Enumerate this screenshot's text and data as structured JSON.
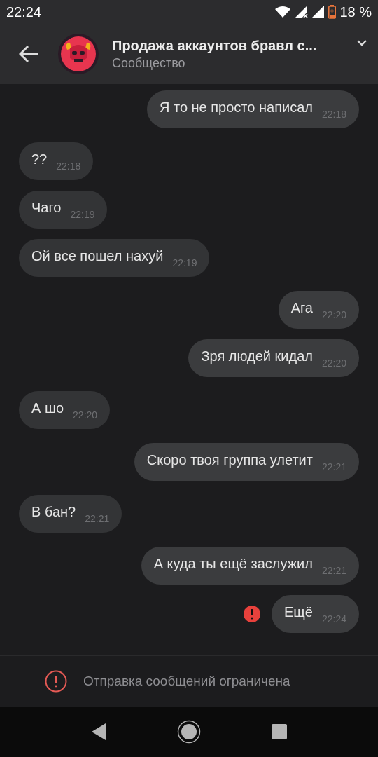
{
  "status_bar": {
    "time": "22:24",
    "battery": "18 %"
  },
  "header": {
    "title": "Продажа аккаунтов бравл с...",
    "subtitle": "Сообщество"
  },
  "messages": [
    {
      "text": "Я то не просто написал",
      "time": "22:18",
      "outgoing": true,
      "failed": false
    },
    {
      "text": "??",
      "time": "22:18",
      "outgoing": false,
      "failed": false
    },
    {
      "text": "Чаго",
      "time": "22:19",
      "outgoing": false,
      "failed": false
    },
    {
      "text": "Ой все пошел нахуй",
      "time": "22:19",
      "outgoing": false,
      "failed": false
    },
    {
      "text": "Ага",
      "time": "22:20",
      "outgoing": true,
      "failed": false
    },
    {
      "text": "Зря людей кидал",
      "time": "22:20",
      "outgoing": true,
      "failed": false
    },
    {
      "text": "А шо",
      "time": "22:20",
      "outgoing": false,
      "failed": false
    },
    {
      "text": "Скоро твоя группа улетит",
      "time": "22:21",
      "outgoing": true,
      "failed": false
    },
    {
      "text": "В бан?",
      "time": "22:21",
      "outgoing": false,
      "failed": false
    },
    {
      "text": "А куда ты ещё заслужил",
      "time": "22:21",
      "outgoing": true,
      "failed": false
    },
    {
      "text": "Ещё",
      "time": "22:24",
      "outgoing": true,
      "failed": true
    }
  ],
  "notice": {
    "text": "Отправка сообщений ограничена"
  }
}
